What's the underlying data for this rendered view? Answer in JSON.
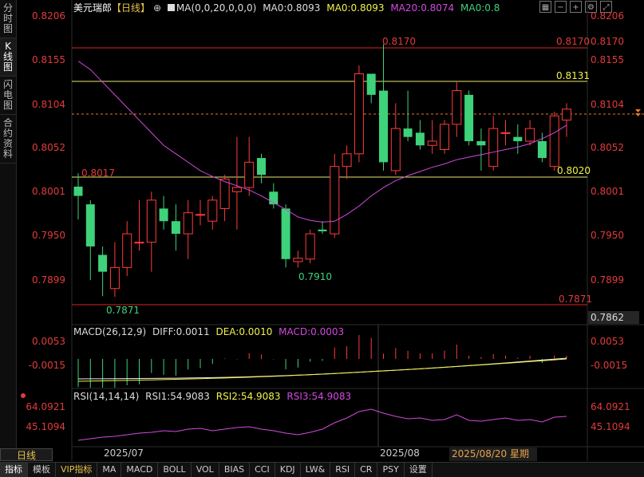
{
  "sidebar": [
    {
      "label": "分时图",
      "active": false
    },
    {
      "label": "K线图",
      "active": true
    },
    {
      "label": "闪电图",
      "active": false
    },
    {
      "label": "合约资料",
      "active": false
    }
  ],
  "header": {
    "symbol": "美元瑞郎",
    "period_tag": "【日线】",
    "ma_settings": "MA(0,0,20,0,0,0)",
    "ma0": "MA0:0.8093",
    "ma0_yellow": "MA0:0.8093",
    "ma20": "MA20:0.8074",
    "ma0_green": "MA0:0.8"
  },
  "price_axis": {
    "left": [
      "0.8206",
      "0.8155",
      "0.8104",
      "0.8052",
      "0.8001",
      "0.7950",
      "0.7899"
    ],
    "right": [
      "0.8206",
      "0.8155",
      "0.8104",
      "0.8052",
      "0.8001",
      "0.7950",
      "0.7899"
    ],
    "right_markers": [
      "0.8170",
      "0.8131",
      "0.8104",
      "0.8052",
      "0.8020",
      "0.7871"
    ],
    "current_price": "0.7862"
  },
  "chart_labels": {
    "high_label": "0.8170",
    "level_0_8131": "0.8131",
    "level_0_8020": "0.8020",
    "left_level": "0.8017",
    "low_label": "0.7910",
    "low_label_2": "0.7871",
    "right_0_8170": "0.8170",
    "right_0_7871": "0.7871"
  },
  "macd": {
    "title": "MACD(26,12,9)",
    "diff": "DIFF:0.0011",
    "dea": "DEA:0.0010",
    "macd": "MACD:0.0003",
    "axis": [
      "0.0053",
      "-0.0015"
    ],
    "axis_right": [
      "0.0053",
      "-0.0015"
    ]
  },
  "rsi": {
    "title": "RSI(14,14,14)",
    "rsi1": "RSI1:54.9083",
    "rsi2": "RSI2:54.9083",
    "rsi3": "RSI3:54.9083",
    "axis": [
      "64.0921",
      "45.1094"
    ],
    "axis_right": [
      "64.0921",
      "45.1094"
    ]
  },
  "xaxis": {
    "period": "日线",
    "month1": "2025/07",
    "month2": "2025/08",
    "cursor_date": "2025/08/20 星期三"
  },
  "toolbar": [
    "指标",
    "模板",
    "VIP指标",
    "MA",
    "MACD",
    "BOLL",
    "VOL",
    "BIAS",
    "CCI",
    "KDJ",
    "LW&",
    "RSI",
    "CR",
    "PSY",
    "设置"
  ],
  "colors": {
    "up": "#ff3b3b",
    "down": "#3ed27a",
    "ma20": "#d24adf",
    "yellow": "#f2f24a",
    "green": "#3ed27a"
  },
  "chart_data": {
    "type": "candlestick",
    "y_range": [
      0.784,
      0.8215
    ],
    "candles": [
      {
        "o": 0.8001,
        "h": 0.8017,
        "l": 0.7962,
        "c": 0.799
      },
      {
        "o": 0.798,
        "h": 0.7985,
        "l": 0.789,
        "c": 0.793
      },
      {
        "o": 0.792,
        "h": 0.793,
        "l": 0.7871,
        "c": 0.79
      },
      {
        "o": 0.788,
        "h": 0.7935,
        "l": 0.787,
        "c": 0.7905
      },
      {
        "o": 0.7905,
        "h": 0.796,
        "l": 0.7895,
        "c": 0.7945
      },
      {
        "o": 0.7935,
        "h": 0.7985,
        "l": 0.7925,
        "c": 0.7935
      },
      {
        "o": 0.7935,
        "h": 0.7995,
        "l": 0.79,
        "c": 0.7985
      },
      {
        "o": 0.7975,
        "h": 0.799,
        "l": 0.795,
        "c": 0.796
      },
      {
        "o": 0.796,
        "h": 0.798,
        "l": 0.7925,
        "c": 0.7945
      },
      {
        "o": 0.7945,
        "h": 0.7985,
        "l": 0.7915,
        "c": 0.797
      },
      {
        "o": 0.7968,
        "h": 0.7985,
        "l": 0.7955,
        "c": 0.7968
      },
      {
        "o": 0.796,
        "h": 0.799,
        "l": 0.795,
        "c": 0.7985
      },
      {
        "o": 0.7975,
        "h": 0.8015,
        "l": 0.796,
        "c": 0.801
      },
      {
        "o": 0.7995,
        "h": 0.806,
        "l": 0.795,
        "c": 0.8
      },
      {
        "o": 0.8,
        "h": 0.806,
        "l": 0.799,
        "c": 0.803
      },
      {
        "o": 0.8035,
        "h": 0.804,
        "l": 0.8005,
        "c": 0.8015
      },
      {
        "o": 0.7995,
        "h": 0.8005,
        "l": 0.7975,
        "c": 0.798
      },
      {
        "o": 0.7975,
        "h": 0.798,
        "l": 0.7905,
        "c": 0.7915
      },
      {
        "o": 0.7912,
        "h": 0.7925,
        "l": 0.7905,
        "c": 0.7916
      },
      {
        "o": 0.7915,
        "h": 0.795,
        "l": 0.791,
        "c": 0.7945
      },
      {
        "o": 0.795,
        "h": 0.796,
        "l": 0.7945,
        "c": 0.7948
      },
      {
        "o": 0.7945,
        "h": 0.804,
        "l": 0.794,
        "c": 0.8025
      },
      {
        "o": 0.8025,
        "h": 0.805,
        "l": 0.801,
        "c": 0.804
      },
      {
        "o": 0.804,
        "h": 0.8145,
        "l": 0.803,
        "c": 0.8135
      },
      {
        "o": 0.8135,
        "h": 0.8135,
        "l": 0.81,
        "c": 0.811
      },
      {
        "o": 0.8115,
        "h": 0.817,
        "l": 0.802,
        "c": 0.803
      },
      {
        "o": 0.802,
        "h": 0.81,
        "l": 0.8015,
        "c": 0.807
      },
      {
        "o": 0.807,
        "h": 0.8115,
        "l": 0.8055,
        "c": 0.806
      },
      {
        "o": 0.8065,
        "h": 0.808,
        "l": 0.8045,
        "c": 0.805
      },
      {
        "o": 0.805,
        "h": 0.808,
        "l": 0.804,
        "c": 0.8055
      },
      {
        "o": 0.8045,
        "h": 0.808,
        "l": 0.804,
        "c": 0.8075
      },
      {
        "o": 0.8075,
        "h": 0.8125,
        "l": 0.806,
        "c": 0.8115
      },
      {
        "o": 0.811,
        "h": 0.8115,
        "l": 0.805,
        "c": 0.8055
      },
      {
        "o": 0.8055,
        "h": 0.807,
        "l": 0.802,
        "c": 0.805
      },
      {
        "o": 0.8025,
        "h": 0.8085,
        "l": 0.802,
        "c": 0.807
      },
      {
        "o": 0.8065,
        "h": 0.808,
        "l": 0.805,
        "c": 0.8065
      },
      {
        "o": 0.806,
        "h": 0.8075,
        "l": 0.804,
        "c": 0.8055
      },
      {
        "o": 0.8055,
        "h": 0.808,
        "l": 0.805,
        "c": 0.807
      },
      {
        "o": 0.8055,
        "h": 0.8065,
        "l": 0.803,
        "c": 0.8035
      },
      {
        "o": 0.8025,
        "h": 0.809,
        "l": 0.802,
        "c": 0.8085
      },
      {
        "o": 0.808,
        "h": 0.81,
        "l": 0.806,
        "c": 0.8093
      }
    ],
    "ma20": [
      0.815,
      0.814,
      0.8125,
      0.811,
      0.8095,
      0.808,
      0.8065,
      0.805,
      0.804,
      0.803,
      0.802,
      0.8013,
      0.8007,
      0.8002,
      0.7997,
      0.799,
      0.7982,
      0.7974,
      0.7965,
      0.7961,
      0.7959,
      0.796,
      0.7968,
      0.7978,
      0.799,
      0.8,
      0.8008,
      0.8014,
      0.8019,
      0.8024,
      0.8028,
      0.8033,
      0.8036,
      0.8039,
      0.8042,
      0.8045,
      0.8048,
      0.8052,
      0.8058,
      0.8065,
      0.8074
    ]
  }
}
